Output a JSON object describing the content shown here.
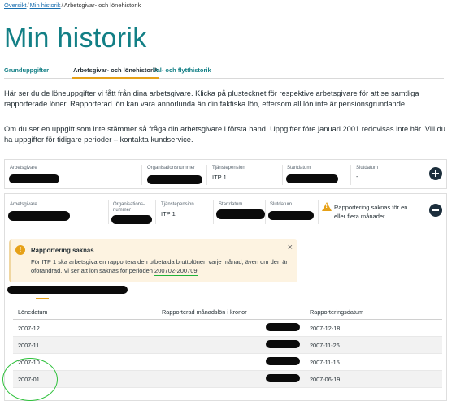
{
  "breadcrumb": {
    "items": [
      "Översikt",
      "Min historik",
      "Arbetsgivar- och lönehistorik"
    ],
    "separator": "/"
  },
  "page_title": "Min historik",
  "tabs": [
    {
      "label": "Grunduppgifter",
      "active": false
    },
    {
      "label": "Arbetsgivar- och lönehistorik",
      "active": true
    },
    {
      "label": "Val- och flytthistorik",
      "active": false
    }
  ],
  "intro": {
    "p1": "Här ser du de löneuppgifter vi fått från dina arbetsgivare. Klicka på plustecknet för respektive arbetsgivare för att se samtliga rapporterade löner. Rapporterad lön kan vara annorlunda än din faktiska lön, eftersom all lön inte är pensionsgrundande.",
    "p2": "Om du ser en uppgift som inte stämmer så fråga din arbetsgivare i första hand. Uppgifter före januari 2001 redovisas inte här. Vill du ha uppgifter för tidigare perioder – kontakta kundservice."
  },
  "employer1": {
    "employer_label": "Arbetsgivare",
    "org_label": "Organisationsnummer",
    "pension_label": "Tjänstepension",
    "pension_value": "ITP 1",
    "start_label": "Startdatum",
    "end_label": "Slutdatum",
    "end_value": "-"
  },
  "employer2": {
    "employer_label": "Arbetsgivare",
    "org_label_line1": "Organisations-",
    "org_label_line2": "nummer",
    "pension_label": "Tjänstepension",
    "pension_value": "ITP 1",
    "start_label": "Startdatum",
    "end_label": "Slutdatum",
    "warning_text": "Rapportering saknas för en eller flera månader.",
    "alert": {
      "title": "Rapportering saknas",
      "body_before": "För ITP 1 ska arbetsgivaren rapportera den utbetalda bruttolönen varje månad, även om den är oförändrad. Vi ser att lön saknas för perioden ",
      "period": "200702-200709",
      "close": "×"
    },
    "table": {
      "headers": [
        "Lönedatum",
        "Rapporterad månadslön i kronor",
        "Rapporteringsdatum"
      ],
      "rows": [
        {
          "date": "2007-12",
          "reported": "2007-12-18"
        },
        {
          "date": "2007-11",
          "reported": "2007-11-26"
        },
        {
          "date": "2007-10",
          "reported": "2007-11-15"
        },
        {
          "date": "2007-01",
          "reported": "2007-06-19"
        }
      ]
    }
  },
  "colors": {
    "accent": "#127f85",
    "warning": "#e6a118",
    "dark_button": "#1c2e3c",
    "annotation_green": "#2fc13c"
  }
}
